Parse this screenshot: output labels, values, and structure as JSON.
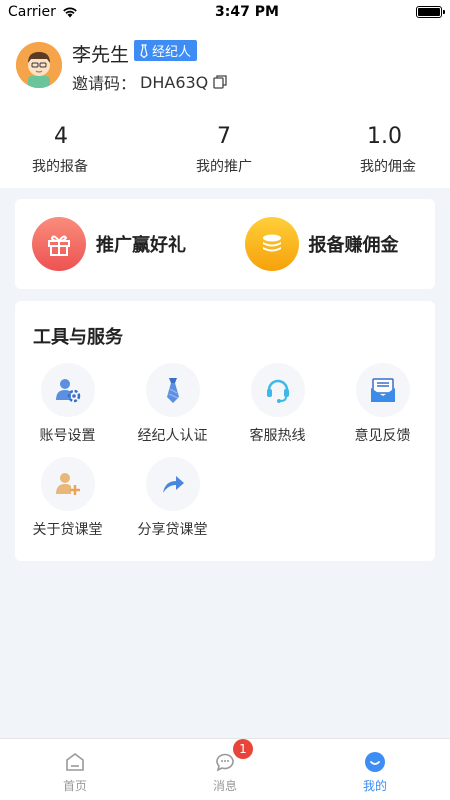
{
  "status_bar": {
    "carrier": "Carrier",
    "time": "3:47 PM"
  },
  "profile": {
    "name": "李先生",
    "badge": "经纪人",
    "invite_label": "邀请码：",
    "invite_code": "DHA63Q"
  },
  "stats": [
    {
      "value": "4",
      "label": "我的报备"
    },
    {
      "value": "7",
      "label": "我的推广"
    },
    {
      "value": "1.0",
      "label": "我的佣金"
    }
  ],
  "promo": [
    {
      "label": "推广赢好礼",
      "icon": "gift-icon",
      "color": "#ee5252"
    },
    {
      "label": "报备赚佣金",
      "icon": "coins-icon",
      "color": "#f6a10b"
    }
  ],
  "tools": {
    "title": "工具与服务",
    "items": [
      {
        "label": "账号设置",
        "icon": "account-settings-icon"
      },
      {
        "label": "经纪人认证",
        "icon": "tie-icon"
      },
      {
        "label": "客服热线",
        "icon": "headset-icon"
      },
      {
        "label": "意见反馈",
        "icon": "mail-icon"
      },
      {
        "label": "关于贷课堂",
        "icon": "user-add-icon"
      },
      {
        "label": "分享贷课堂",
        "icon": "share-icon"
      }
    ]
  },
  "tab_bar": {
    "tabs": [
      {
        "label": "首页",
        "icon": "home-icon"
      },
      {
        "label": "消息",
        "icon": "message-icon",
        "badge": "1"
      },
      {
        "label": "我的",
        "icon": "profile-icon",
        "active": true
      }
    ]
  },
  "colors": {
    "accent": "#3d8df5",
    "badge_red": "#e8443a",
    "background": "#f1f4f8"
  }
}
